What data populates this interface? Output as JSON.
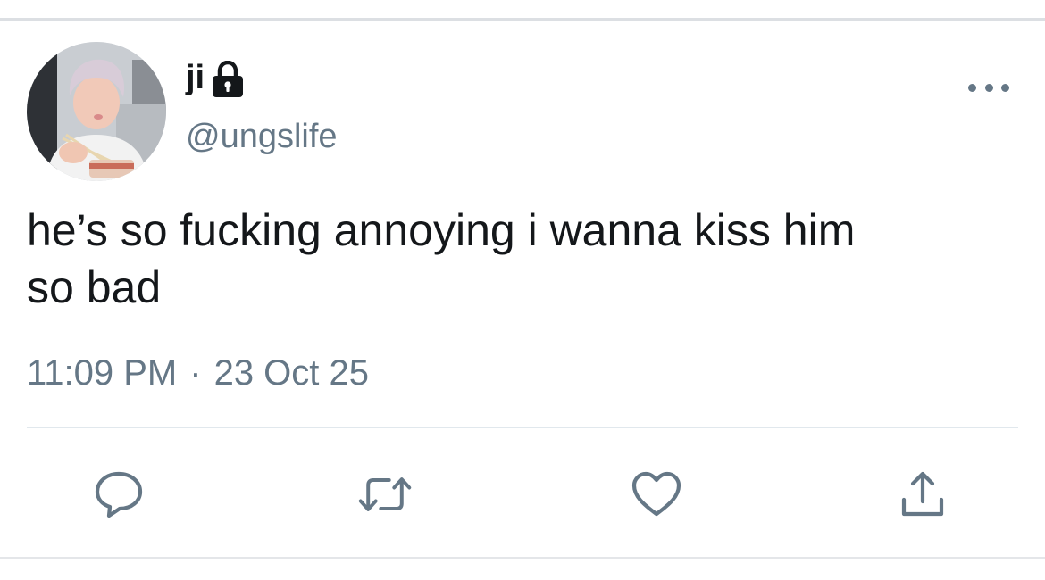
{
  "tweet": {
    "author": {
      "display_name": "ji",
      "handle": "@ungslife",
      "protected_icon": "lock-icon",
      "avatar": "profile photo"
    },
    "text_line1": "he’s so fucking annoying i wanna kiss him",
    "text_line2": "so bad",
    "time": "11:09 PM",
    "separator": "·",
    "date": "23 Oct 25",
    "menu_icon": "more-options-icon"
  },
  "actions": [
    {
      "icon": "reply-icon"
    },
    {
      "icon": "retweet-icon"
    },
    {
      "icon": "like-icon"
    },
    {
      "icon": "share-icon"
    }
  ],
  "colors": {
    "text_primary": "#14171a",
    "text_secondary": "#657786",
    "divider": "#e1e8ed",
    "background": "#ffffff"
  }
}
